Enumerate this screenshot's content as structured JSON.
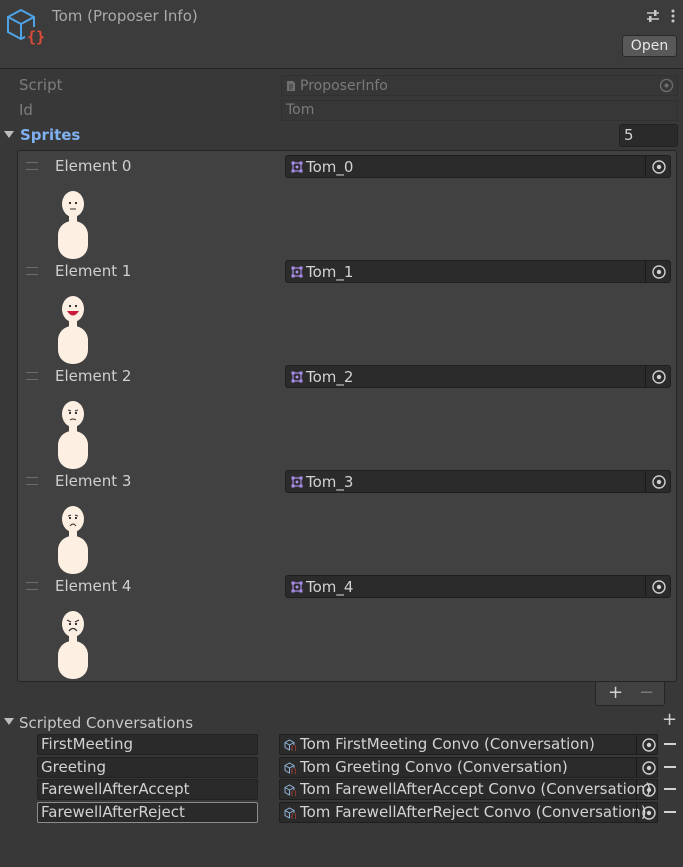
{
  "header": {
    "title": "Tom (Proposer Info)",
    "open_label": "Open",
    "icon": "scriptable-object-icon"
  },
  "fields": {
    "script_label": "Script",
    "script_value": "ProposerInfo",
    "id_label": "Id",
    "id_value": "Tom"
  },
  "sprites": {
    "label": "Sprites",
    "count": "5",
    "elements": [
      {
        "label": "Element 0",
        "value": "Tom_0",
        "expression": "neutral"
      },
      {
        "label": "Element 1",
        "value": "Tom_1",
        "expression": "happy"
      },
      {
        "label": "Element 2",
        "value": "Tom_2",
        "expression": "unsure"
      },
      {
        "label": "Element 3",
        "value": "Tom_3",
        "expression": "sad"
      },
      {
        "label": "Element 4",
        "value": "Tom_4",
        "expression": "upset"
      }
    ],
    "add_label": "+",
    "remove_label": "−"
  },
  "conversations": {
    "label": "Scripted Conversations",
    "add_label": "+",
    "items": [
      {
        "key": "FirstMeeting",
        "value": "Tom FirstMeeting Convo (Conversation)"
      },
      {
        "key": "Greeting",
        "value": "Tom Greeting Convo (Conversation)"
      },
      {
        "key": "FarewellAfterAccept",
        "value": "Tom FarewellAfterAccept Convo (Conversation)"
      },
      {
        "key": "FarewellAfterReject",
        "value": "Tom FarewellAfterReject Convo (Conversation)"
      }
    ]
  },
  "colors": {
    "background": "#383838",
    "accent_label": "#7fb0f0",
    "skin": "#fdf0e3",
    "icon_blue": "#4ea3e6",
    "icon_red": "#e04a3a"
  }
}
